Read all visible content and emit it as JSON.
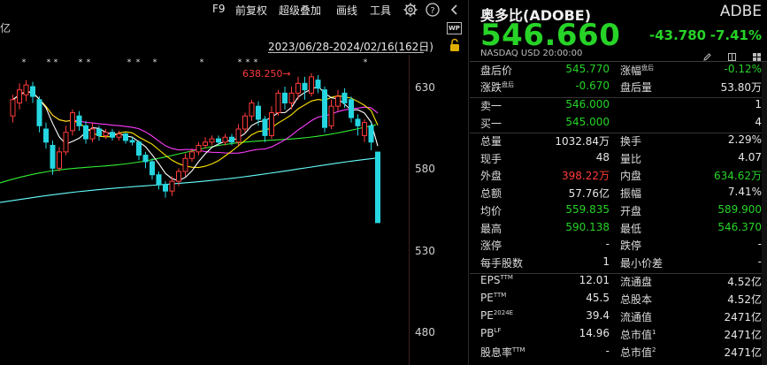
{
  "toolbar": {
    "f9": "F9",
    "adjust": "前复权",
    "overlay": "超级叠加",
    "draw": "画线",
    "tools": "工具"
  },
  "chart": {
    "unit_label": "亿",
    "date_range": "2023/06/28-2024/02/16(162日)",
    "badge": "WP",
    "max_label": "638.250",
    "arrow": "→",
    "price_ticks": [
      "630",
      "580",
      "530",
      "480"
    ]
  },
  "chart_data": {
    "type": "candlestick",
    "y_ticks": [
      630,
      580,
      530,
      480
    ],
    "ylim": [
      470,
      660
    ],
    "max_label": 638.25,
    "colors": {
      "up": "#ff3b3b",
      "down": "#25d6e0",
      "ma5": "#ffffff",
      "ma10": "#ffe600",
      "ma20": "#ff3bff",
      "ma60": "#33ee33",
      "ma120": "#66ffff"
    },
    "candles": [
      {
        "o": 612,
        "c": 622,
        "h": 625,
        "l": 608
      },
      {
        "o": 620,
        "c": 628,
        "h": 632,
        "l": 616
      },
      {
        "o": 625,
        "c": 631,
        "h": 634,
        "l": 621
      },
      {
        "o": 630,
        "c": 624,
        "h": 633,
        "l": 620
      },
      {
        "o": 622,
        "c": 606,
        "h": 624,
        "l": 602
      },
      {
        "o": 604,
        "c": 596,
        "h": 608,
        "l": 592
      },
      {
        "o": 594,
        "c": 580,
        "h": 597,
        "l": 576
      },
      {
        "o": 580,
        "c": 590,
        "h": 593,
        "l": 578
      },
      {
        "o": 590,
        "c": 602,
        "h": 606,
        "l": 588
      },
      {
        "o": 603,
        "c": 614,
        "h": 616,
        "l": 600
      },
      {
        "o": 612,
        "c": 606,
        "h": 615,
        "l": 603
      },
      {
        "o": 606,
        "c": 598,
        "h": 609,
        "l": 595
      },
      {
        "o": 598,
        "c": 604,
        "h": 608,
        "l": 596
      },
      {
        "o": 604,
        "c": 600,
        "h": 606,
        "l": 597
      },
      {
        "o": 600,
        "c": 602,
        "h": 604,
        "l": 598
      },
      {
        "o": 602,
        "c": 599,
        "h": 604,
        "l": 597
      },
      {
        "o": 599,
        "c": 601,
        "h": 603,
        "l": 597
      },
      {
        "o": 601,
        "c": 597,
        "h": 602,
        "l": 595
      },
      {
        "o": 597,
        "c": 596,
        "h": 599,
        "l": 594
      },
      {
        "o": 596,
        "c": 588,
        "h": 597,
        "l": 585
      },
      {
        "o": 588,
        "c": 584,
        "h": 590,
        "l": 580
      },
      {
        "o": 584,
        "c": 576,
        "h": 586,
        "l": 573
      },
      {
        "o": 576,
        "c": 570,
        "h": 578,
        "l": 567
      },
      {
        "o": 570,
        "c": 566,
        "h": 572,
        "l": 562
      },
      {
        "o": 566,
        "c": 572,
        "h": 575,
        "l": 563
      },
      {
        "o": 572,
        "c": 578,
        "h": 580,
        "l": 569
      },
      {
        "o": 578,
        "c": 586,
        "h": 589,
        "l": 575
      },
      {
        "o": 586,
        "c": 590,
        "h": 592,
        "l": 584
      },
      {
        "o": 590,
        "c": 594,
        "h": 596,
        "l": 588
      },
      {
        "o": 594,
        "c": 596,
        "h": 599,
        "l": 592
      },
      {
        "o": 596,
        "c": 598,
        "h": 600,
        "l": 594
      },
      {
        "o": 598,
        "c": 596,
        "h": 600,
        "l": 594
      },
      {
        "o": 596,
        "c": 599,
        "h": 601,
        "l": 594
      },
      {
        "o": 599,
        "c": 596,
        "h": 601,
        "l": 594
      },
      {
        "o": 596,
        "c": 604,
        "h": 607,
        "l": 594
      },
      {
        "o": 604,
        "c": 612,
        "h": 614,
        "l": 602
      },
      {
        "o": 612,
        "c": 620,
        "h": 622,
        "l": 609
      },
      {
        "o": 618,
        "c": 610,
        "h": 621,
        "l": 606
      },
      {
        "o": 610,
        "c": 600,
        "h": 612,
        "l": 596
      },
      {
        "o": 600,
        "c": 614,
        "h": 618,
        "l": 598
      },
      {
        "o": 614,
        "c": 626,
        "h": 628,
        "l": 612
      },
      {
        "o": 626,
        "c": 620,
        "h": 630,
        "l": 616
      },
      {
        "o": 620,
        "c": 626,
        "h": 630,
        "l": 616
      },
      {
        "o": 626,
        "c": 632,
        "h": 636,
        "l": 622
      },
      {
        "o": 632,
        "c": 628,
        "h": 636,
        "l": 622
      },
      {
        "o": 626,
        "c": 636,
        "h": 638.25,
        "l": 624
      },
      {
        "o": 634,
        "c": 629,
        "h": 637,
        "l": 626
      },
      {
        "o": 628,
        "c": 605,
        "h": 630,
        "l": 602
      },
      {
        "o": 606,
        "c": 618,
        "h": 622,
        "l": 604
      },
      {
        "o": 618,
        "c": 624,
        "h": 628,
        "l": 615
      },
      {
        "o": 626,
        "c": 620,
        "h": 629,
        "l": 617
      },
      {
        "o": 622,
        "c": 611,
        "h": 624,
        "l": 608
      },
      {
        "o": 610,
        "c": 606,
        "h": 613,
        "l": 600
      },
      {
        "o": 600,
        "c": 608,
        "h": 610,
        "l": 596
      },
      {
        "o": 606,
        "c": 596,
        "h": 608,
        "l": 591
      },
      {
        "o": 589.9,
        "c": 546.66,
        "h": 590.138,
        "l": 546.37
      }
    ]
  },
  "quote": {
    "name": "奥多比(ADOBE)",
    "ticker": "ADBE",
    "price": "546.660",
    "change": "-43.780",
    "change_pct": "-7.41%",
    "exchange": "NASDAQ  USD  20:00:00",
    "rows": [
      {
        "l1": "盘后价",
        "v1": "545.770",
        "c1": "g",
        "l2": "涨幅",
        "s2": "盘后",
        "v2": "-0.12%",
        "c2": "g"
      },
      {
        "l1": "涨跌",
        "s1": "盘后",
        "v1": "-0.670",
        "c1": "g",
        "l2": "盘后量",
        "v2": "53.80万",
        "c2": "w"
      },
      {
        "l1": "卖一",
        "v1": "546.000",
        "c1": "g",
        "l2": "",
        "v2": "1",
        "c2": "w"
      },
      {
        "l1": "买一",
        "v1": "545.000",
        "c1": "g",
        "l2": "",
        "v2": "4",
        "c2": "w"
      },
      {
        "l1": "总量",
        "v1": "1032.84万",
        "c1": "w",
        "l2": "换手",
        "v2": "2.29%",
        "c2": "w"
      },
      {
        "l1": "现手",
        "v1": "48",
        "c1": "w",
        "l2": "量比",
        "v2": "4.07",
        "c2": "w"
      },
      {
        "l1": "外盘",
        "v1": "398.22万",
        "c1": "r",
        "l2": "内盘",
        "v2": "634.62万",
        "c2": "g"
      },
      {
        "l1": "总额",
        "v1": "57.76亿",
        "c1": "w",
        "l2": "振幅",
        "v2": "7.41%",
        "c2": "w"
      },
      {
        "l1": "均价",
        "v1": "559.835",
        "c1": "g",
        "l2": "开盘",
        "v2": "589.900",
        "c2": "g"
      },
      {
        "l1": "最高",
        "v1": "590.138",
        "c1": "g",
        "l2": "最低",
        "v2": "546.370",
        "c2": "g"
      },
      {
        "l1": "涨停",
        "v1": "-",
        "c1": "w",
        "l2": "跌停",
        "v2": "-",
        "c2": "w"
      },
      {
        "l1": "每手股数",
        "v1": "1",
        "c1": "w",
        "l2": "最小价差",
        "v2": "-",
        "c2": "w"
      },
      {
        "l1": "EPS",
        "s1": "TTM",
        "v1": "12.01",
        "c1": "w",
        "l2": "流通盘",
        "v2": "4.52亿",
        "c2": "w"
      },
      {
        "l1": "PE",
        "s1": "TTM",
        "v1": "45.5",
        "c1": "w",
        "l2": "总股本",
        "v2": "4.52亿",
        "c2": "w"
      },
      {
        "l1": "PE",
        "s1": "2024E",
        "v1": "39.4",
        "c1": "w",
        "l2": "流通值",
        "v2": "2471亿",
        "c2": "w"
      },
      {
        "l1": "PB",
        "s1": "LF",
        "v1": "14.96",
        "c1": "w",
        "l2": "总市值",
        "s2": "1",
        "v2": "2471亿",
        "c2": "w"
      },
      {
        "l1": "股息率",
        "s1": "TTM",
        "v1": "-",
        "c1": "w",
        "l2": "总市值",
        "s2": "2",
        "v2": "2471亿",
        "c2": "w"
      }
    ]
  }
}
